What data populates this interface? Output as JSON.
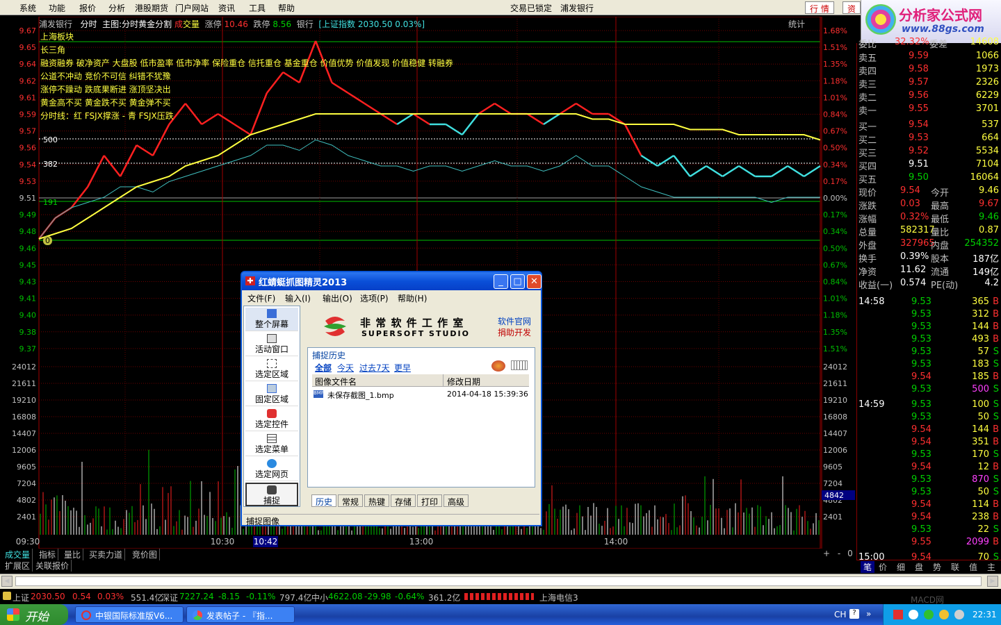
{
  "menubar": {
    "items": [
      "系统",
      "功能",
      "报价",
      "分析",
      "港股期货",
      "门户网站",
      "资讯",
      "工具",
      "帮助"
    ],
    "status": "交易已锁定",
    "stock": "浦发银行",
    "btn_quote": "行  情",
    "btn_trade": "资"
  },
  "logo": {
    "name": "分析家公式网",
    "url": "www.88gs.com",
    "faint": "600000 浦发银行"
  },
  "infobar": {
    "stock": "浦发银行",
    "mode": "分时",
    "main": "主图:分时黄金分割",
    "vol_a": "成",
    "vol_b": "交量",
    "limit_up_label": "涨停",
    "limit_up": "10.46",
    "limit_down_label": "跌停",
    "limit_down": "8.56",
    "sector": "银行",
    "index_info": "[上证指数 2030.50 0.03%]",
    "stat": "统计"
  },
  "overlay_text": {
    "l1": "上海板块",
    "l1b": "长三角",
    "l2": "融资融券 破净资产 大盘股 低市盈率 低市净率 保险重仓 信托重仓 基金重仓 价值优势 价值发现 价值稳健 转融券",
    "l3": "公道不冲动  竞价不可信  纠错不犹豫",
    "l4": "涨停不躁动  跌底果断进  涨顶坚决出",
    "l5": "黄金高不买  黄金跌不买  黄金弹不买",
    "l6": "分时线：红 FSJX撑涨 - 青 FSJX压跌",
    "lv500": "500",
    "lv382": "382",
    "lv191": "191",
    "lv0": "0"
  },
  "axes": {
    "left_price": [
      "9.67",
      "9.65",
      "9.64",
      "9.62",
      "9.61",
      "9.59",
      "9.57",
      "9.56",
      "9.54",
      "9.53",
      "9.51",
      "9.49",
      "9.48",
      "9.46",
      "9.45",
      "9.43",
      "9.41",
      "9.40",
      "9.38",
      "9.37"
    ],
    "left_vol": [
      "24012",
      "21611",
      "19210",
      "16808",
      "14407",
      "12006",
      "9605",
      "7204",
      "4802",
      "2401"
    ],
    "right_pct": [
      "1.68%",
      "1.51%",
      "1.35%",
      "1.18%",
      "1.01%",
      "0.84%",
      "0.67%",
      "0.50%",
      "0.34%",
      "0.17%",
      "0.00%",
      "0.17%",
      "0.34%",
      "0.50%",
      "0.67%",
      "0.84%",
      "1.01%",
      "1.18%",
      "1.35%",
      "1.51%"
    ],
    "right_vol": [
      "24012",
      "21611",
      "19210",
      "16808",
      "14407",
      "12006",
      "9605",
      "7204",
      "4802",
      "2401"
    ],
    "cursor_vol": "4842",
    "times": [
      "09:30",
      "10:30",
      "13:00",
      "14:00"
    ],
    "cursor_time": "10:42"
  },
  "chart_data": [
    {
      "type": "line",
      "name": "intraday price",
      "ylim": [
        9.46,
        9.67
      ],
      "minutes": [
        0,
        5,
        10,
        15,
        20,
        25,
        30,
        35,
        40,
        45,
        50,
        55,
        60,
        65,
        70,
        75,
        80,
        85,
        90,
        95,
        100,
        105,
        110,
        115,
        120,
        125,
        130,
        135,
        140,
        145,
        150,
        155,
        160,
        165,
        170,
        175,
        180,
        185,
        190,
        195,
        200,
        205,
        210,
        215,
        220,
        225,
        230,
        235,
        240
      ],
      "series": [
        {
          "values": [
            9.47,
            9.49,
            9.5,
            9.52,
            9.55,
            9.53,
            9.56,
            9.55,
            9.58,
            9.6,
            9.58,
            9.59,
            9.58,
            9.57,
            9.61,
            9.63,
            9.62,
            9.66,
            9.62,
            9.61,
            9.6,
            9.59,
            9.58,
            9.59,
            9.58,
            9.58,
            9.57,
            9.59,
            9.6,
            9.59,
            9.59,
            9.58,
            9.59,
            9.6,
            9.59,
            9.59,
            9.58,
            9.55,
            9.54,
            9.55,
            9.53,
            9.54,
            9.53,
            9.54,
            9.53,
            9.53,
            9.54,
            9.53,
            9.54
          ]
        },
        {
          "values": [
            9.47,
            9.475,
            9.48,
            9.49,
            9.5,
            9.51,
            9.52,
            9.525,
            9.53,
            9.54,
            9.545,
            9.55,
            9.56,
            9.57,
            9.575,
            9.58,
            9.585,
            9.59,
            9.59,
            9.59,
            9.59,
            9.59,
            9.59,
            9.59,
            9.59,
            9.59,
            9.59,
            9.59,
            9.59,
            9.59,
            9.59,
            9.59,
            9.59,
            9.59,
            9.585,
            9.585,
            9.58,
            9.58,
            9.58,
            9.58,
            9.575,
            9.575,
            9.575,
            9.57,
            9.57,
            9.57,
            9.57,
            9.57,
            9.565
          ]
        },
        {
          "values": [
            9.47,
            9.49,
            9.5,
            9.505,
            9.51,
            9.52,
            9.52,
            9.515,
            9.525,
            9.53,
            9.535,
            9.54,
            9.545,
            9.55,
            9.56,
            9.56,
            9.555,
            9.565,
            9.56,
            9.55,
            9.545,
            9.54,
            9.54,
            9.535,
            9.54,
            9.54,
            9.535,
            9.54,
            9.545,
            9.54,
            9.54,
            9.535,
            9.54,
            9.55,
            9.54,
            9.54,
            9.53,
            9.52,
            9.515,
            9.51,
            9.51,
            9.51,
            9.51,
            9.51,
            9.51,
            9.505,
            9.51,
            9.51,
            9.51
          ]
        }
      ],
      "gold_levels": {
        "500": 9.565,
        "382": 9.54,
        "191": 9.51
      }
    }
  ],
  "right_panel": {
    "wei_label": "委比",
    "wei_val": "32.32%",
    "cha_label": "委差",
    "cha_val": "14608",
    "asks": [
      {
        "label": "卖五",
        "price": "9.59",
        "vol": "1066"
      },
      {
        "label": "卖四",
        "price": "9.58",
        "vol": "1973"
      },
      {
        "label": "卖三",
        "price": "9.57",
        "vol": "2326"
      },
      {
        "label": "卖二",
        "price": "9.56",
        "vol": "6229"
      },
      {
        "label": "卖一",
        "price": "9.55",
        "vol": "3701"
      }
    ],
    "bids": [
      {
        "label": "买一",
        "price": "9.54",
        "vol": "537"
      },
      {
        "label": "买二",
        "price": "9.53",
        "vol": "664"
      },
      {
        "label": "买三",
        "price": "9.52",
        "vol": "5534"
      },
      {
        "label": "买四",
        "price": "9.51",
        "vol": "7104"
      },
      {
        "label": "买五",
        "price": "9.50",
        "vol": "16064"
      }
    ],
    "stats": [
      {
        "l1": "现价",
        "v1": "9.54",
        "l2": "今开",
        "v2": "9.46"
      },
      {
        "l1": "涨跌",
        "v1": "0.03",
        "l2": "最高",
        "v2": "9.67"
      },
      {
        "l1": "涨幅",
        "v1": "0.32%",
        "l2": "最低",
        "v2": "9.46"
      },
      {
        "l1": "总量",
        "v1": "582317",
        "l2": "量比",
        "v2": "0.87"
      },
      {
        "l1": "外盘",
        "v1": "327965",
        "l2": "内盘",
        "v2": "254352"
      },
      {
        "l1": "换手",
        "v1": "0.39%",
        "l2": "股本",
        "v2": "187亿"
      },
      {
        "l1": "净资",
        "v1": "11.62",
        "l2": "流通",
        "v2": "149亿"
      },
      {
        "l1": "收益(一)",
        "v1": "0.574",
        "l2": "PE(动)",
        "v2": "4.2"
      }
    ],
    "ticks": [
      {
        "t": "14:58",
        "p": "9.53",
        "v": "365",
        "d": "B"
      },
      {
        "t": "",
        "p": "9.53",
        "v": "312",
        "d": "B"
      },
      {
        "t": "",
        "p": "9.53",
        "v": "144",
        "d": "B"
      },
      {
        "t": "",
        "p": "9.53",
        "v": "493",
        "d": "B"
      },
      {
        "t": "",
        "p": "9.53",
        "v": "57",
        "d": "S"
      },
      {
        "t": "",
        "p": "9.53",
        "v": "183",
        "d": "S"
      },
      {
        "t": "",
        "p": "9.54",
        "v": "185",
        "d": "B"
      },
      {
        "t": "",
        "p": "9.53",
        "v": "500",
        "d": "S"
      },
      {
        "t": "14:59",
        "p": "9.53",
        "v": "100",
        "d": "S"
      },
      {
        "t": "",
        "p": "9.53",
        "v": "50",
        "d": "S"
      },
      {
        "t": "",
        "p": "9.54",
        "v": "144",
        "d": "B"
      },
      {
        "t": "",
        "p": "9.54",
        "v": "351",
        "d": "B"
      },
      {
        "t": "",
        "p": "9.53",
        "v": "170",
        "d": "S"
      },
      {
        "t": "",
        "p": "9.54",
        "v": "12",
        "d": "B"
      },
      {
        "t": "",
        "p": "9.53",
        "v": "870",
        "d": "S"
      },
      {
        "t": "",
        "p": "9.53",
        "v": "50",
        "d": "S"
      },
      {
        "t": "",
        "p": "9.54",
        "v": "114",
        "d": "B"
      },
      {
        "t": "",
        "p": "9.54",
        "v": "238",
        "d": "B"
      },
      {
        "t": "",
        "p": "9.53",
        "v": "22",
        "d": "S"
      },
      {
        "t": "",
        "p": "9.55",
        "v": "2099",
        "d": "B"
      },
      {
        "t": "15:00",
        "p": "9.54",
        "v": "70",
        "d": "S"
      }
    ],
    "tabs": [
      "笔",
      "价",
      "细",
      "盘",
      "势",
      "联",
      "值",
      "主"
    ]
  },
  "bottom_tabs": [
    "成交量",
    "指标",
    "量比",
    "买卖力道",
    "竞价图"
  ],
  "bottom_tabs2": [
    "扩展区",
    "关联报价"
  ],
  "zoom_btns": [
    "+",
    "-",
    "0"
  ],
  "statusbar": {
    "sh_label": "上证",
    "sh_val": "2030.50",
    "sh_chg": "0.54",
    "sh_pct": "0.03%",
    "sh_amt": "551.4亿",
    "sz_label": "深证",
    "sz_val": "7227.24",
    "sz_chg": "-8.15",
    "sz_pct": "-0.11%",
    "sz_amt": "797.4亿",
    "zx_label": "中小",
    "zx_val": "4622.08",
    "zx_chg": "-29.98",
    "zx_pct": "-0.64%",
    "zx_amt": "361.2亿",
    "ticker": "上海电信3",
    "watermark": "MACD网"
  },
  "taskbar": {
    "start": "开始",
    "tasks": [
      "中银国际标准版V6...",
      "发表帖子 - 『指..."
    ],
    "tray_lang": "CH",
    "clock": "22:31"
  },
  "dialog": {
    "title": "红蜻蜓抓图精灵2013",
    "menu": [
      "文件(F)",
      "输入(I)",
      "输出(O)",
      "选项(P)",
      "帮助(H)"
    ],
    "tools": [
      "整个屏幕",
      "活动窗口",
      "选定区域",
      "固定区域",
      "选定控件",
      "选定菜单",
      "选定网页"
    ],
    "capture": "捕捉",
    "brand_cn": "非 常 软 件 工 作 室",
    "brand_en": "SUPERSOFT STUDIO",
    "link_site": "软件官网",
    "link_donate": "捐助开发",
    "history_title": "捕捉历史",
    "filters": [
      "全部",
      "今天",
      "过去7天",
      "更早"
    ],
    "col_name": "图像文件名",
    "col_date": "修改日期",
    "file_name": "未保存截图_1.bmp",
    "file_date": "2014-04-18 15:39:36",
    "bottom_tabs": [
      "历史",
      "常规",
      "热键",
      "存储",
      "打印",
      "高级"
    ],
    "status": "捕捉图像"
  }
}
